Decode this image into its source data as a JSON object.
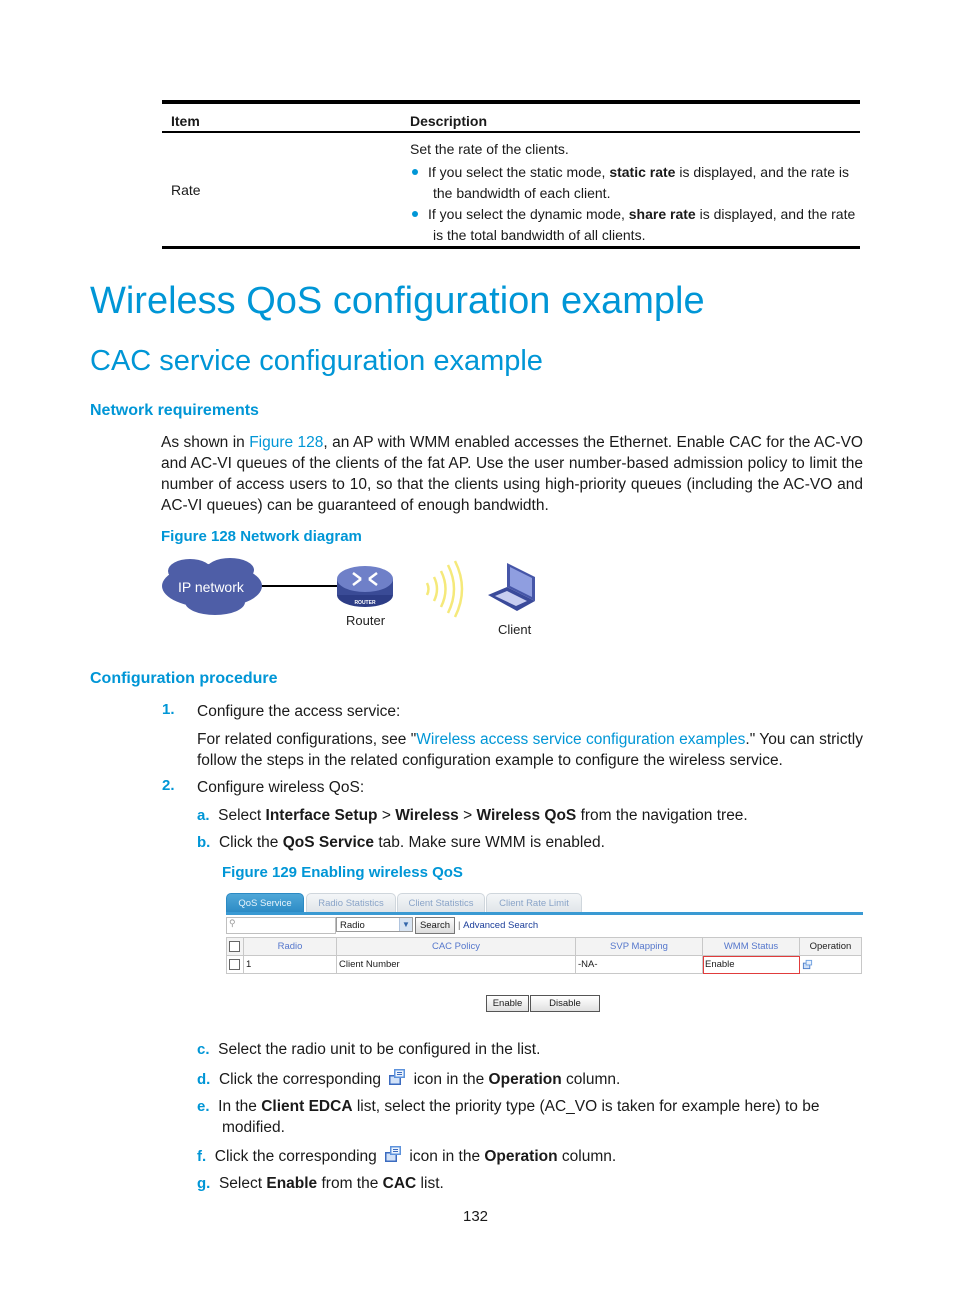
{
  "top_table": {
    "headers": [
      "Item",
      "Description"
    ],
    "rows": [
      {
        "item": "Rate",
        "intro": "Set the rate of the clients.",
        "bullets": [
          {
            "pre": "If you select the static mode, ",
            "bold": "static rate",
            "post_line1": " is displayed, and the rate is",
            "line2": "the bandwidth of each client."
          },
          {
            "pre": "If you select the dynamic mode, ",
            "bold": "share rate",
            "post_line1": " is displayed, and the rate",
            "line2": "is the total bandwidth of all clients."
          }
        ]
      }
    ]
  },
  "h1": "Wireless QoS configuration example",
  "h2": "CAC service configuration example",
  "network_requirements": {
    "heading": "Network requirements",
    "para_pre": "As shown in ",
    "para_link": "Figure 128",
    "para_post": ", an AP with WMM enabled accesses the Ethernet. Enable CAC for the AC-VO and AC-VI queues of the clients of the fat AP. Use the user number-based admission policy to limit the number of access users to 10, so that the clients using high-priority queues (including the AC-VO and AC-VI queues) can be guaranteed of enough bandwidth.",
    "figure_caption": "Figure 128 Network diagram",
    "diagram": {
      "cloud_label": "IP network",
      "router_label": "Router",
      "router_badge": "ROUTER",
      "client_label": "Client"
    }
  },
  "configuration_procedure": {
    "heading": "Configuration procedure",
    "steps": [
      {
        "num": "1.",
        "text": "Configure the access service:"
      },
      {
        "num": "2.",
        "text": "Configure wireless QoS:"
      }
    ],
    "step1_para_pre": "For related configurations, see \"",
    "step1_para_link": "Wireless access service configuration examples",
    "step1_para_post": ".\" You can strictly follow the steps in the related configuration example to configure the wireless service.",
    "substeps": {
      "a": {
        "label": "a.",
        "t1": "Select ",
        "b1": "Interface Setup",
        "t2": " > ",
        "b2": "Wireless",
        "t3": " > ",
        "b3": "Wireless QoS",
        "t4": " from the navigation tree."
      },
      "b": {
        "label": "b.",
        "t1": "Click the ",
        "b1": "QoS Service",
        "t2": " tab. Make sure WMM is enabled."
      },
      "c": {
        "label": "c.",
        "t1": "Select the radio unit to be configured in the list."
      },
      "d": {
        "label": "d.",
        "t1": "Click the corresponding",
        "t2": "icon in the ",
        "b1": "Operation",
        "t3": " column."
      },
      "e": {
        "label": "e.",
        "t1": "In the ",
        "b1": "Client EDCA",
        "t2": " list, select the priority type (AC_VO is taken for example here) to be",
        "line2": "modified."
      },
      "f": {
        "label": "f.",
        "t1": "Click the corresponding",
        "t2": "icon in the ",
        "b1": "Operation",
        "t3": " column."
      },
      "g": {
        "label": "g.",
        "t1": "Select ",
        "b1": "Enable",
        "t2": " from the ",
        "b2": "CAC",
        "t3": " list."
      }
    },
    "figure129_caption": "Figure 129 Enabling wireless QoS"
  },
  "ui": {
    "tabs": [
      "QoS Service",
      "Radio Statistics",
      "Client Statistics",
      "Client Rate Limit"
    ],
    "active_tab": "QoS Service",
    "search_placeholder": "",
    "select_value": "Radio",
    "search_button": "Search",
    "advanced_search": "Advanced Search",
    "columns": [
      "Radio",
      "CAC Policy",
      "SVP Mapping",
      "WMM Status",
      "Operation"
    ],
    "rows": [
      {
        "radio": "1",
        "cac_policy": "Client Number",
        "svp_mapping": "-NA-",
        "wmm_status": "Enable"
      }
    ],
    "enable_button": "Enable",
    "disable_button": "Disable",
    "highlight_color": "#e03c3c"
  },
  "page_number": "132"
}
